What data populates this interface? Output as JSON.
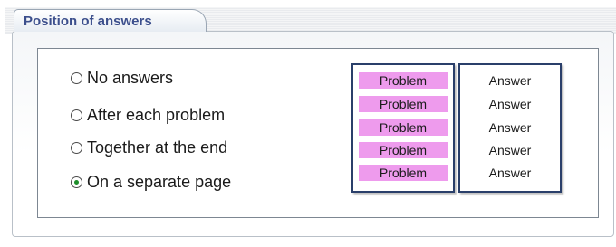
{
  "section": {
    "tab_title": "Position of answers"
  },
  "options": [
    {
      "label": "No answers",
      "checked": false
    },
    {
      "label": "After each problem",
      "checked": false
    },
    {
      "label": "Together at the end",
      "checked": false
    },
    {
      "label": "On a separate page",
      "checked": true
    }
  ],
  "preview": {
    "problems": [
      "Problem",
      "Problem",
      "Problem",
      "Problem",
      "Problem"
    ],
    "answers": [
      "Answer",
      "Answer",
      "Answer",
      "Answer",
      "Answer"
    ]
  },
  "colors": {
    "tab_title": "#3c4f8c",
    "problem_fill": "#ee9bed",
    "preview_border": "#2a3f6a",
    "radio_selected": "#1e8e2b"
  }
}
